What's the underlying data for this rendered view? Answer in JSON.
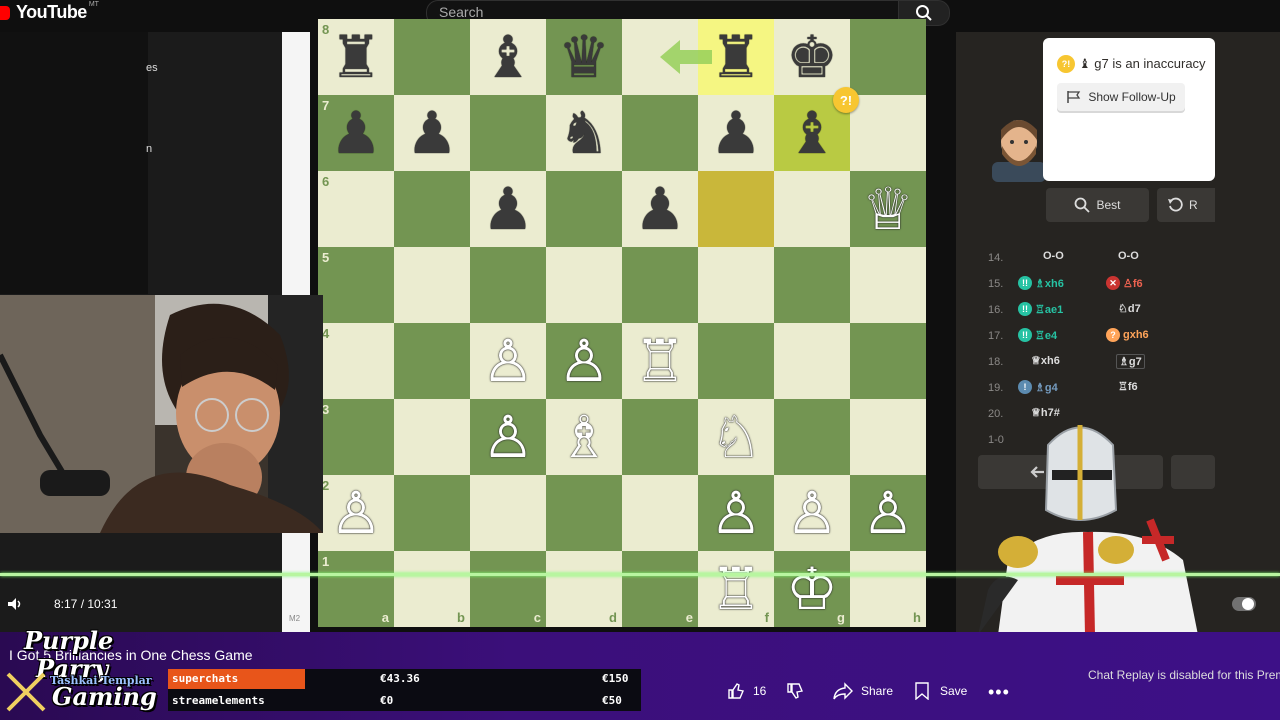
{
  "app": {
    "name": "YouTube",
    "region": "MT"
  },
  "search": {
    "placeholder": "Search"
  },
  "board": {
    "ranks": [
      "8",
      "7",
      "6",
      "5",
      "4",
      "3",
      "2",
      "1"
    ],
    "files": [
      "a",
      "b",
      "c",
      "d",
      "e",
      "f",
      "g",
      "h"
    ],
    "pieces": [
      [
        "♜",
        "",
        "♝",
        "♛",
        "",
        "♜",
        "♚",
        ""
      ],
      [
        "♟",
        "♟",
        "",
        "♞",
        "",
        "♟",
        "♝",
        ""
      ],
      [
        "",
        "",
        "♟",
        "",
        "♟",
        "",
        "",
        "♕"
      ],
      [
        "",
        "",
        "",
        "",
        "",
        "",
        "",
        ""
      ],
      [
        "",
        "",
        "♙",
        "♙",
        "♖",
        "",
        "",
        ""
      ],
      [
        "",
        "",
        "♙",
        "♗",
        "",
        "♘",
        "",
        ""
      ],
      [
        "♙",
        "",
        "",
        "",
        "",
        "♙",
        "♙",
        "♙"
      ],
      [
        "",
        "",
        "",
        "",
        "",
        "♖",
        "♔",
        ""
      ]
    ],
    "inaccuracy_badge": "?!"
  },
  "coach": {
    "message": "♝ g7 is an inaccuracy",
    "follow_up": "Show Follow-Up",
    "best": "Best",
    "retry": "R"
  },
  "moves": [
    {
      "num": "14.",
      "w": "O-O",
      "b": "O-O"
    },
    {
      "num": "15.",
      "w": "xh6",
      "b": "f6"
    },
    {
      "num": "16.",
      "w": "ae1",
      "b": "d7"
    },
    {
      "num": "17.",
      "w": "e4",
      "b": "gxh6"
    },
    {
      "num": "18.",
      "w": "xh6",
      "b": "g7"
    },
    {
      "num": "19.",
      "w": "g4",
      "b": "f6"
    },
    {
      "num": "20.",
      "w": "h7#",
      "b": ""
    }
  ],
  "result": "1-0",
  "player": {
    "time": "8:17 / 10:31"
  },
  "video": {
    "title": "I Got 5 Brilliancies in One Chess Game"
  },
  "brand": {
    "line1": "Purple",
    "line2": "Parry",
    "line3": "Gaming",
    "sub": "Tashkai Templar"
  },
  "overlay": [
    {
      "name": "superchats",
      "v1": "€43.36",
      "v2": "€150"
    },
    {
      "name": "streamelements",
      "v1": "€0",
      "v2": "€50"
    }
  ],
  "actions": {
    "likes": "16",
    "share": "Share",
    "save": "Save"
  },
  "chat": {
    "disabled": "Chat Replay is disabled for this Premie"
  },
  "left": {
    "labels": [
      "es",
      "n"
    ]
  },
  "misc": {
    "m2": "M2"
  }
}
